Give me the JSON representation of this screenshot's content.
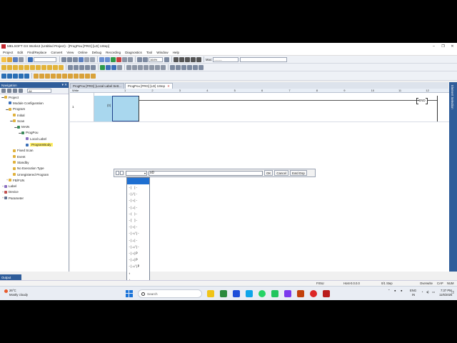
{
  "window": {
    "title": "MELSOFT GX Works3 (Untitled Project) - [ProgPou [PRG] [LD] 1Step]",
    "buttons": [
      "–",
      "❐",
      "✕"
    ]
  },
  "menu": [
    "Project",
    "Edit",
    "Find/Replace",
    "Convert",
    "View",
    "Online",
    "Debug",
    "Recording",
    "Diagnostics",
    "Tool",
    "Window",
    "Help"
  ],
  "toolbar": {
    "zoom": "164%",
    "max_label": "Max:",
    "max_value": "--------"
  },
  "navigation": {
    "title": "Navigation",
    "filter": "All",
    "items": [
      {
        "label": "Project",
        "level": 0,
        "exp": "▬",
        "icon": "folder-icon"
      },
      {
        "label": "Module Configuration",
        "level": 1,
        "exp": "",
        "icon": "module-icon"
      },
      {
        "label": "Program",
        "level": 1,
        "exp": "▬",
        "icon": "folder-icon"
      },
      {
        "label": "Initial",
        "level": 2,
        "exp": "",
        "icon": "folder-icon"
      },
      {
        "label": "Scan",
        "level": 2,
        "exp": "▬",
        "icon": "folder-icon"
      },
      {
        "label": "MAIN",
        "level": 3,
        "exp": "▬",
        "icon": "program-icon"
      },
      {
        "label": "ProgPou",
        "level": 4,
        "exp": "▬",
        "icon": "program-icon"
      },
      {
        "label": "Local Label",
        "level": 5,
        "exp": "",
        "icon": "label-icon"
      },
      {
        "label": "ProgramBody",
        "level": 5,
        "exp": "",
        "icon": "program-body-icon",
        "selected": true
      },
      {
        "label": "Fixed Scan",
        "level": 2,
        "exp": "",
        "icon": "folder-icon"
      },
      {
        "label": "Event",
        "level": 2,
        "exp": "",
        "icon": "folder-icon"
      },
      {
        "label": "Standby",
        "level": 2,
        "exp": "",
        "icon": "folder-icon"
      },
      {
        "label": "No Execution Type",
        "level": 2,
        "exp": "",
        "icon": "folder-icon"
      },
      {
        "label": "Unregistered Program",
        "level": 2,
        "exp": "",
        "icon": "folder-icon"
      },
      {
        "label": "FB/FUN",
        "level": 1,
        "exp": "+",
        "icon": "folder-icon"
      },
      {
        "label": "Label",
        "level": 0,
        "exp": "+",
        "icon": "label-icon"
      },
      {
        "label": "Device",
        "level": 0,
        "exp": "+",
        "icon": "device-icon"
      },
      {
        "label": "Parameter",
        "level": 0,
        "exp": "+",
        "icon": "parameter-icon"
      }
    ]
  },
  "tabs": [
    {
      "label": "ProgPou [PRG] [Local Label Sett...",
      "active": false
    },
    {
      "label": "ProgPou [PRG] [LD] 1Step",
      "active": true,
      "close": "✕"
    }
  ],
  "right_pane": "Element Selection",
  "editor": {
    "write_label": "Write",
    "columns": [
      "1",
      "2",
      "3",
      "4",
      "5",
      "6",
      "7",
      "8",
      "9",
      "10",
      "11",
      "12"
    ],
    "row_number": "1",
    "rung_marker": "(0)",
    "end_label": "END"
  },
  "instruction_input": {
    "value": "x0",
    "ok": "OK",
    "cancel": "Cancel",
    "extended": "Extd Dsp"
  },
  "instruction_options": [
    "-| |-",
    "-|/|-",
    "-|↑|-",
    "-|↓|-",
    "-( )-",
    "-[ ]-",
    "-|↑|-",
    "-|↑/|-",
    "-|↓|-",
    "-|↓/|-",
    "-|↑|P",
    "-|↓|P",
    "-|↓/|P",
    "↑",
    "↓",
    "⊕/⊖"
  ],
  "output_tab": "Output",
  "status": {
    "cpu": "FX5U",
    "host": "Host-0.0.0.0",
    "step": "0/1 Step",
    "mode": "Overwrite",
    "caps": "CAP",
    "num": "NUM"
  },
  "taskbar": {
    "weather_temp": "26°C",
    "weather_desc": "Mostly cloudy",
    "search": "Search",
    "lang": "ENG",
    "region": "IN",
    "time": "7:37 PM",
    "date": "11/6/2025"
  }
}
